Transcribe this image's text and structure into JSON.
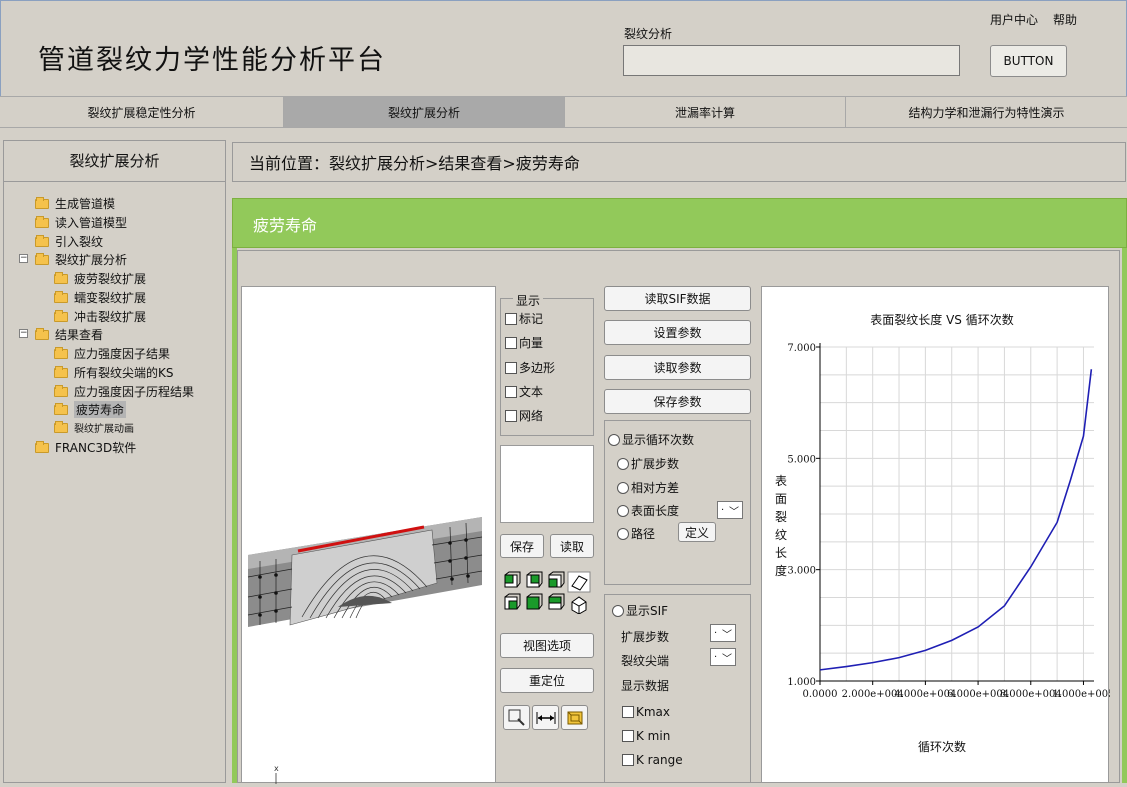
{
  "header": {
    "title": "管道裂纹力学性能分析平台",
    "search_label": "裂纹分析",
    "search_value": "",
    "user_center": "用户中心",
    "help": "帮助",
    "button_label": "BUTTON"
  },
  "tabs": [
    {
      "label": "裂纹扩展稳定性分析"
    },
    {
      "label": "裂纹扩展分析"
    },
    {
      "label": "泄漏率计算"
    },
    {
      "label": "结构力学和泄漏行为特性演示"
    }
  ],
  "sidebar": {
    "title": "裂纹扩展分析",
    "items": [
      {
        "label": "生成管道模"
      },
      {
        "label": "读入管道模型"
      },
      {
        "label": "引入裂纹"
      },
      {
        "label": "裂纹扩展分析"
      },
      {
        "label": "疲劳裂纹扩展"
      },
      {
        "label": "蠕变裂纹扩展"
      },
      {
        "label": "冲击裂纹扩展"
      },
      {
        "label": "结果查看"
      },
      {
        "label": "应力强度因子结果"
      },
      {
        "label": "所有裂纹尖端的KS"
      },
      {
        "label": "应力强度因子历程结果"
      },
      {
        "label": "疲劳寿命"
      },
      {
        "label": "裂纹扩展动画"
      },
      {
        "label": "FRANC3D软件"
      }
    ]
  },
  "breadcrumb": "当前位置：裂纹扩展分析>结果查看>疲劳寿命",
  "panel_title": "疲劳寿命",
  "display": {
    "legend": "显示",
    "options": [
      "标记",
      "向量",
      "多边形",
      "文本",
      "网络"
    ],
    "save": "保存",
    "read": "读取",
    "view_options": "视图选项",
    "reposition": "重定位"
  },
  "actions": {
    "read_sif": "读取SIF数据",
    "set_params": "设置参数",
    "read_params": "读取参数",
    "save_params": "保存参数"
  },
  "cycles": {
    "show_cycles": "显示循环次数",
    "steps": "扩展步数",
    "rel_var": "相对方差",
    "surface_len": "表面长度",
    "path": "路径",
    "define": "定义",
    "dd_value": "·"
  },
  "sif": {
    "show_sif": "显示SIF",
    "steps": "扩展步数",
    "crack_tip": "裂纹尖端",
    "show_data": "显示数据",
    "kmax": "Kmax",
    "kmin": "K min",
    "krange": "K range",
    "dd_value": "·"
  },
  "chart_data": {
    "type": "line",
    "title": "表面裂纹长度 VS 循环次数",
    "xlabel": "循环次数",
    "ylabel": "表面裂纹长度",
    "xlim": [
      0,
      104000
    ],
    "ylim": [
      1,
      7
    ],
    "x_ticks": [
      "0.0000",
      "2.000e+004",
      "4.000e+004",
      "6.000e+004",
      "8.000e+004",
      "1.000e+005"
    ],
    "x_tick_values": [
      0,
      20000,
      40000,
      60000,
      80000,
      100000
    ],
    "y_ticks": [
      "1.000",
      "3.000",
      "5.000",
      "7.000"
    ],
    "y_tick_values": [
      1,
      3,
      5,
      7
    ],
    "grid": true,
    "series": [
      {
        "color": "#1f1fb4",
        "x": [
          0,
          10000,
          20000,
          30000,
          40000,
          50000,
          60000,
          70000,
          80000,
          90000,
          95000,
          100000,
          103000
        ],
        "y": [
          1.2,
          1.26,
          1.33,
          1.42,
          1.55,
          1.73,
          1.97,
          2.35,
          3.05,
          3.85,
          4.6,
          5.4,
          6.6
        ]
      }
    ]
  }
}
